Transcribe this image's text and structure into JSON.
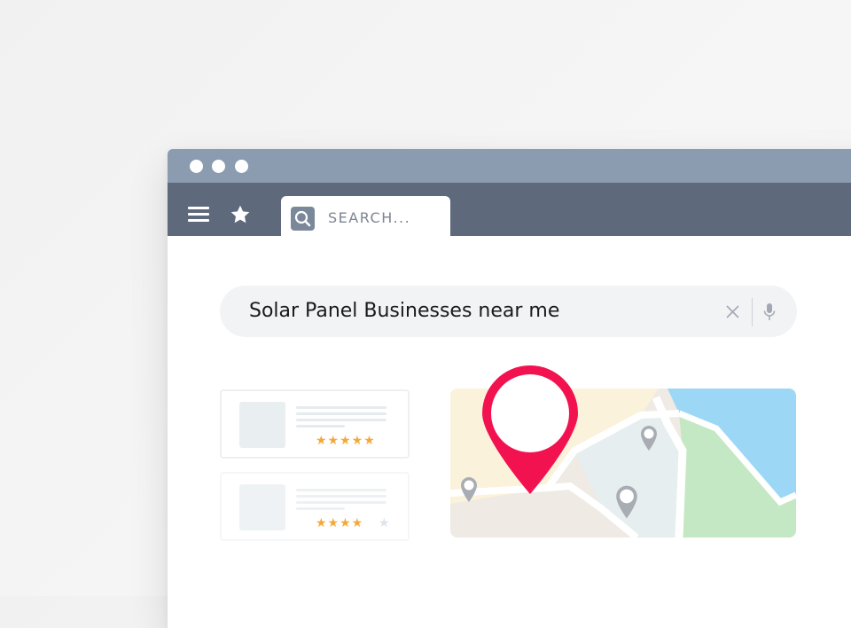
{
  "window": {
    "title_dots": [
      "window-dot-1",
      "window-dot-2",
      "window-dot-3"
    ]
  },
  "toolbar": {
    "menu_icon": "hamburger-menu-icon",
    "bookmark_icon": "star-icon",
    "tab": {
      "icon": "search-icon",
      "placeholder": "SEARCH..."
    }
  },
  "search": {
    "query": "Solar Panel Businesses near me",
    "clear_icon": "close-icon",
    "voice_icon": "microphone-icon"
  },
  "results": [
    {
      "stars_text": "★★★★★",
      "rating": 5,
      "max": 5
    },
    {
      "stars_text": "★★★★",
      "rating": 4,
      "max": 5
    }
  ],
  "colors": {
    "titlebar": "#8b9bb0",
    "toolbar": "#5e6a7b",
    "pin": "#f2124f",
    "star": "#f3a93a",
    "star_empty": "#dde3ec",
    "map_water": "#9cd8f6",
    "map_park": "#c4e8c4",
    "map_sand": "#fbf2dc"
  }
}
